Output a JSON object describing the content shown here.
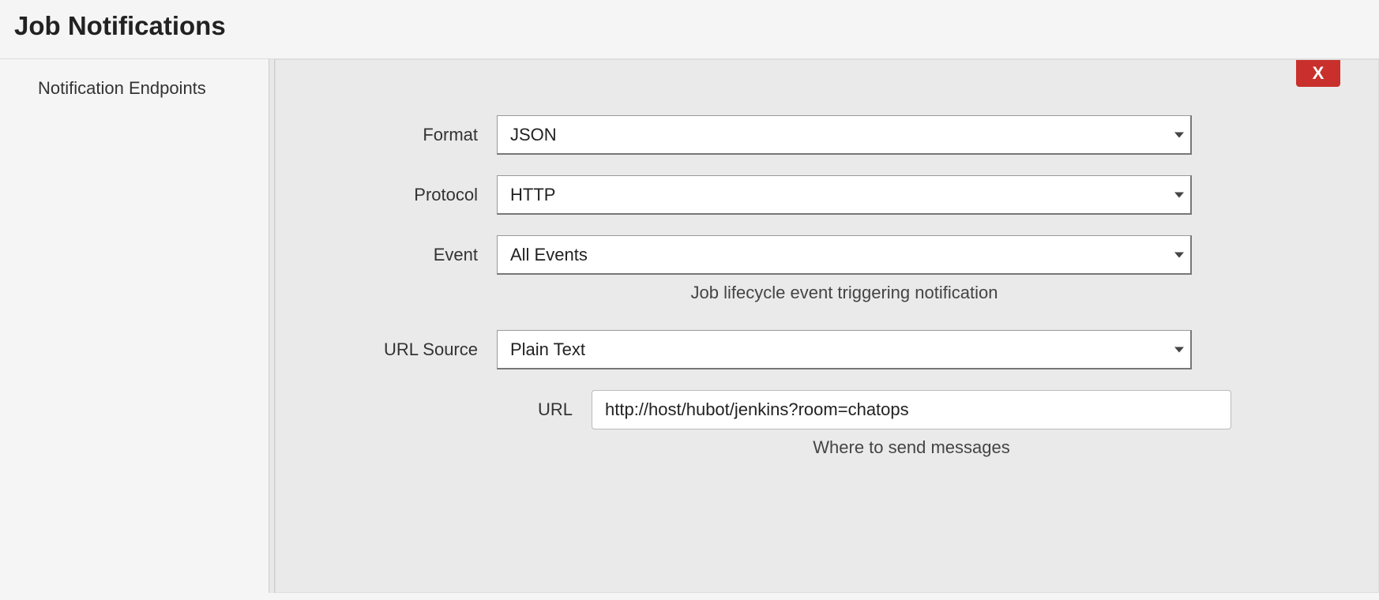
{
  "header": {
    "title": "Job Notifications"
  },
  "sidebar": {
    "label": "Notification Endpoints"
  },
  "close": {
    "label": "X"
  },
  "form": {
    "format": {
      "label": "Format",
      "value": "JSON"
    },
    "protocol": {
      "label": "Protocol",
      "value": "HTTP"
    },
    "event": {
      "label": "Event",
      "value": "All Events",
      "help": "Job lifecycle event triggering notification"
    },
    "urlsource": {
      "label": "URL Source",
      "value": "Plain Text"
    },
    "url": {
      "label": "URL",
      "value": "http://host/hubot/jenkins?room=chatops",
      "help": "Where to send messages"
    }
  }
}
